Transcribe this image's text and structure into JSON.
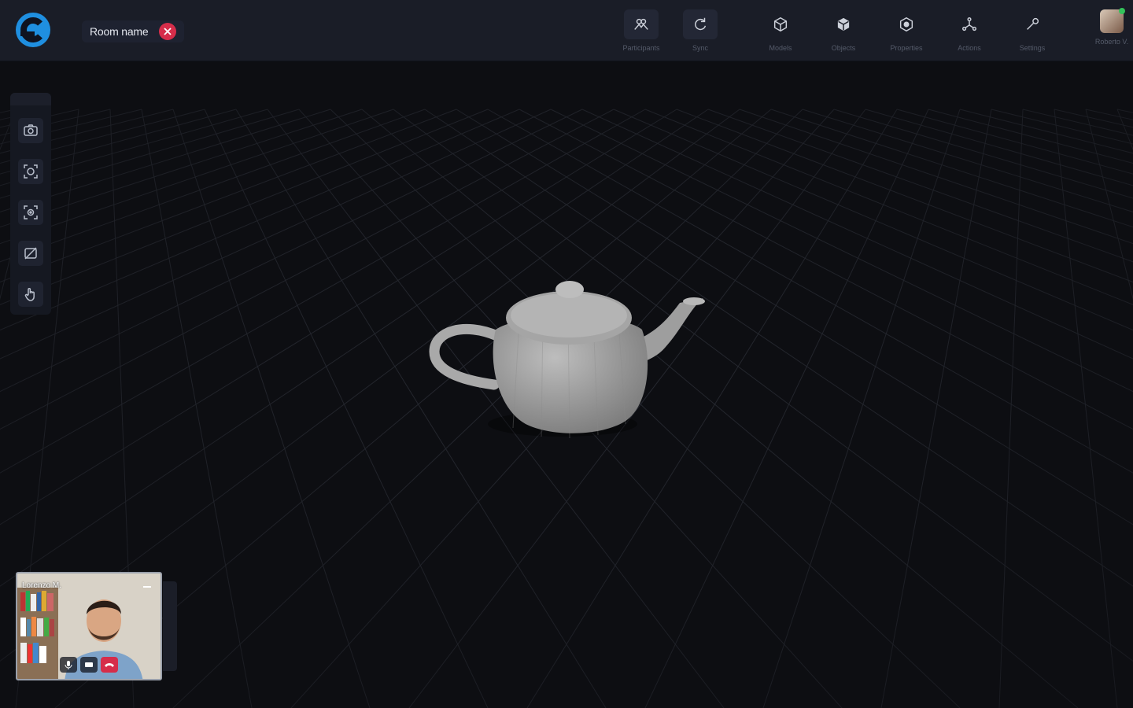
{
  "room": {
    "name": "Room name"
  },
  "nav": [
    {
      "id": "participants",
      "label": "Participants",
      "icon": "participants-icon",
      "active": true
    },
    {
      "id": "sync",
      "label": "Sync",
      "icon": "sync-icon",
      "active": true
    },
    {
      "id": "models",
      "label": "Models",
      "icon": "models-icon"
    },
    {
      "id": "objects",
      "label": "Objects",
      "icon": "objects-icon"
    },
    {
      "id": "properties",
      "label": "Properties",
      "icon": "properties-icon"
    },
    {
      "id": "actions",
      "label": "Actions",
      "icon": "actions-icon"
    },
    {
      "id": "settings",
      "label": "Settings",
      "icon": "settings-icon"
    }
  ],
  "user": {
    "label": "Roberto V."
  },
  "tools": [
    "camera-icon",
    "focus-icon",
    "target-icon",
    "hide-icon",
    "hand-icon"
  ],
  "video": {
    "participant": "Lorenzo M."
  },
  "colors": {
    "accent": "#1f8fe0",
    "danger": "#d62d4a",
    "online": "#33c25a"
  }
}
